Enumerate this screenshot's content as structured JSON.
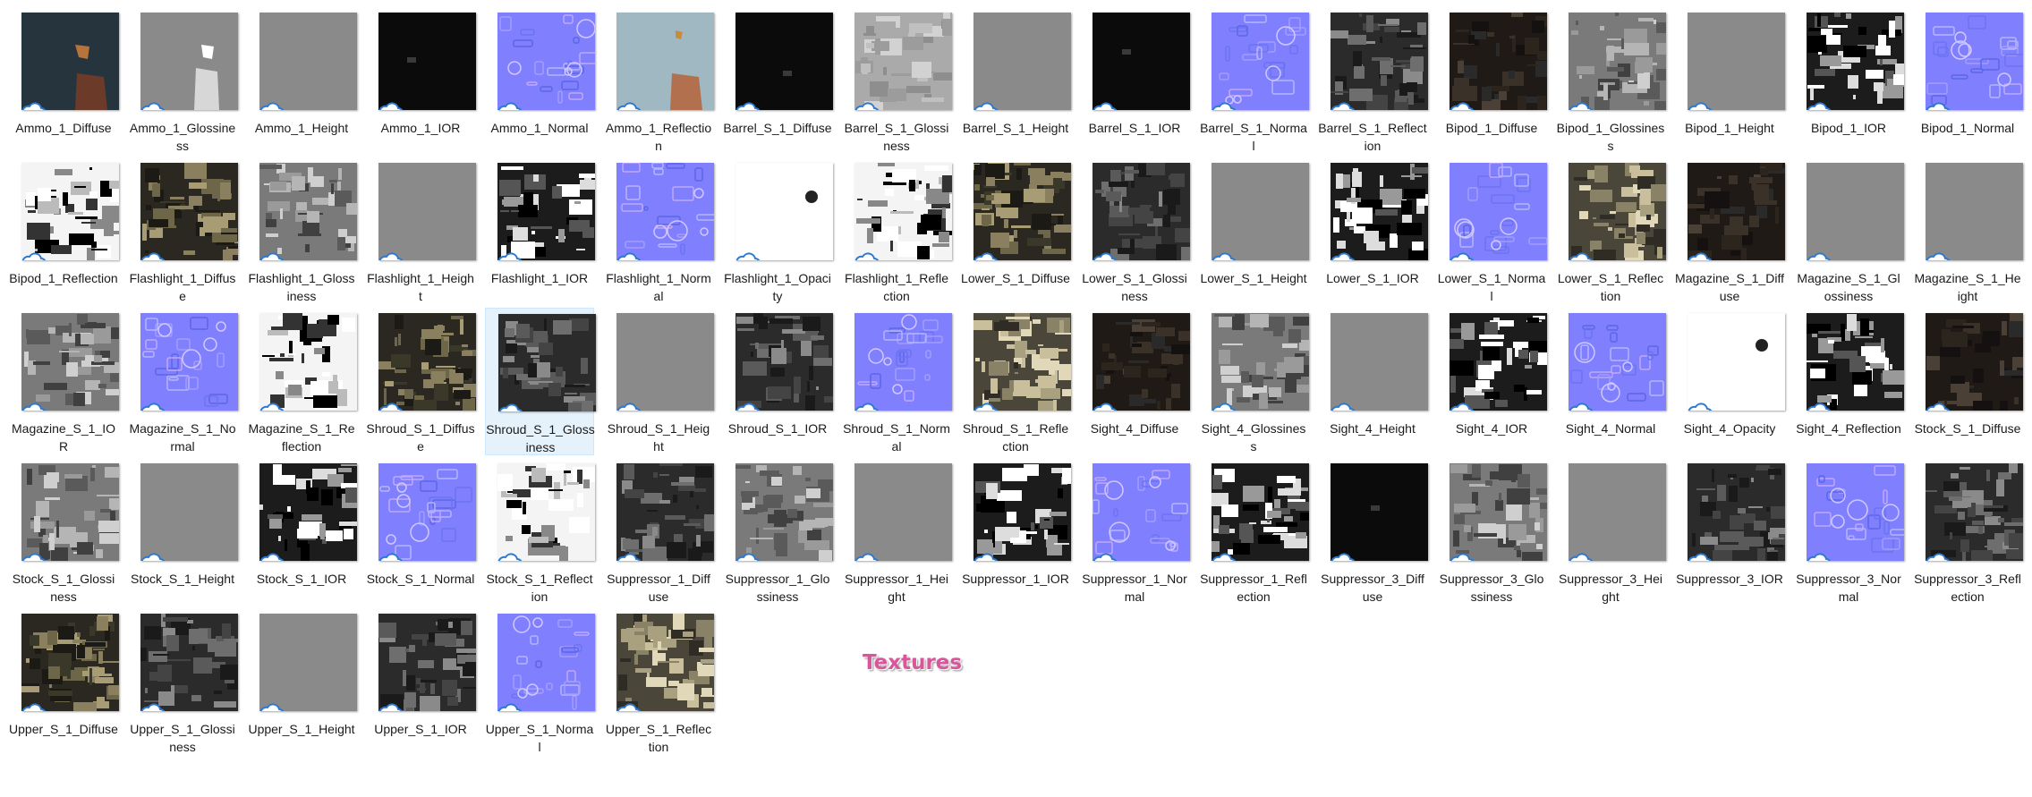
{
  "files": [
    {
      "name": "Ammo_1_Diffuse",
      "kind": "ammo_diffuse"
    },
    {
      "name": "Ammo_1_Glossiness",
      "kind": "ammo_gloss"
    },
    {
      "name": "Ammo_1_Height",
      "kind": "flatgray"
    },
    {
      "name": "Ammo_1_IOR",
      "kind": "black"
    },
    {
      "name": "Ammo_1_Normal",
      "kind": "normal"
    },
    {
      "name": "Ammo_1_Reflection",
      "kind": "ammo_refl"
    },
    {
      "name": "Barrel_S_1_Diffuse",
      "kind": "black"
    },
    {
      "name": "Barrel_S_1_Glossiness",
      "kind": "lightgray_tex"
    },
    {
      "name": "Barrel_S_1_Height",
      "kind": "flatgray"
    },
    {
      "name": "Barrel_S_1_IOR",
      "kind": "black"
    },
    {
      "name": "Barrel_S_1_Normal",
      "kind": "normal"
    },
    {
      "name": "Barrel_S_1_Reflection",
      "kind": "darkgray_tex"
    },
    {
      "name": "Bipod_1_Diffuse",
      "kind": "darkbrown_tex"
    },
    {
      "name": "Bipod_1_Glossiness",
      "kind": "gray_tex"
    },
    {
      "name": "Bipod_1_Height",
      "kind": "flatgray"
    },
    {
      "name": "Bipod_1_IOR",
      "kind": "bw_tex"
    },
    {
      "name": "Bipod_1_Normal",
      "kind": "normal"
    },
    {
      "name": "Bipod_1_Reflection",
      "kind": "white_tex"
    },
    {
      "name": "Flashlight_1_Diffuse",
      "kind": "darkolive_tex"
    },
    {
      "name": "Flashlight_1_Glossiness",
      "kind": "gray_tex"
    },
    {
      "name": "Flashlight_1_Height",
      "kind": "flatgray"
    },
    {
      "name": "Flashlight_1_IOR",
      "kind": "bw_tex"
    },
    {
      "name": "Flashlight_1_Normal",
      "kind": "normal"
    },
    {
      "name": "Flashlight_1_Opacity",
      "kind": "white"
    },
    {
      "name": "Flashlight_1_Reflection",
      "kind": "white_tex"
    },
    {
      "name": "Lower_S_1_Diffuse",
      "kind": "darkolive_tex"
    },
    {
      "name": "Lower_S_1_Glossiness",
      "kind": "darkgray_tex"
    },
    {
      "name": "Lower_S_1_Height",
      "kind": "flatgray"
    },
    {
      "name": "Lower_S_1_IOR",
      "kind": "bw_tex"
    },
    {
      "name": "Lower_S_1_Normal",
      "kind": "normal"
    },
    {
      "name": "Lower_S_1_Reflection",
      "kind": "beige_tex"
    },
    {
      "name": "Magazine_S_1_Diffuse",
      "kind": "darkbrown_tex"
    },
    {
      "name": "Magazine_S_1_Glossiness",
      "kind": "flatgray"
    },
    {
      "name": "Magazine_S_1_Height",
      "kind": "flatgray"
    },
    {
      "name": "Magazine_S_1_IOR",
      "kind": "gray_tex"
    },
    {
      "name": "Magazine_S_1_Normal",
      "kind": "normal"
    },
    {
      "name": "Magazine_S_1_Reflection",
      "kind": "white_tex"
    },
    {
      "name": "Shroud_S_1_Diffuse",
      "kind": "darkolive_tex"
    },
    {
      "name": "Shroud_S_1_Glossiness",
      "kind": "darkgray_tex"
    },
    {
      "name": "Shroud_S_1_Height",
      "kind": "flatgray"
    },
    {
      "name": "Shroud_S_1_IOR",
      "kind": "darkgray_tex"
    },
    {
      "name": "Shroud_S_1_Normal",
      "kind": "normal"
    },
    {
      "name": "Shroud_S_1_Reflection",
      "kind": "beige_tex"
    },
    {
      "name": "Sight_4_Diffuse",
      "kind": "darkbrown_tex"
    },
    {
      "name": "Sight_4_Glossiness",
      "kind": "gray_tex"
    },
    {
      "name": "Sight_4_Height",
      "kind": "flatgray"
    },
    {
      "name": "Sight_4_IOR",
      "kind": "bw_tex"
    },
    {
      "name": "Sight_4_Normal",
      "kind": "normal"
    },
    {
      "name": "Sight_4_Opacity",
      "kind": "white"
    },
    {
      "name": "Sight_4_Reflection",
      "kind": "bw_tex"
    },
    {
      "name": "Stock_S_1_Diffuse",
      "kind": "darkbrown_tex"
    },
    {
      "name": "Stock_S_1_Glossiness",
      "kind": "gray_tex"
    },
    {
      "name": "Stock_S_1_Height",
      "kind": "flatgray"
    },
    {
      "name": "Stock_S_1_IOR",
      "kind": "bw_tex"
    },
    {
      "name": "Stock_S_1_Normal",
      "kind": "normal"
    },
    {
      "name": "Stock_S_1_Reflection",
      "kind": "white_tex"
    },
    {
      "name": "Suppressor_1_Diffuse",
      "kind": "darkgray_tex"
    },
    {
      "name": "Suppressor_1_Glossiness",
      "kind": "gray_tex"
    },
    {
      "name": "Suppressor_1_Height",
      "kind": "flatgray"
    },
    {
      "name": "Suppressor_1_IOR",
      "kind": "bw_tex"
    },
    {
      "name": "Suppressor_1_Normal",
      "kind": "normal"
    },
    {
      "name": "Suppressor_1_Reflection",
      "kind": "bw_tex"
    },
    {
      "name": "Suppressor_3_Diffuse",
      "kind": "black"
    },
    {
      "name": "Suppressor_3_Glossiness",
      "kind": "gray_tex"
    },
    {
      "name": "Suppressor_3_Height",
      "kind": "flatgray"
    },
    {
      "name": "Suppressor_3_IOR",
      "kind": "darkgray_tex"
    },
    {
      "name": "Suppressor_3_Normal",
      "kind": "normal"
    },
    {
      "name": "Suppressor_3_Reflection",
      "kind": "darkgray_tex"
    },
    {
      "name": "Upper_S_1_Diffuse",
      "kind": "darkolive_tex"
    },
    {
      "name": "Upper_S_1_Glossiness",
      "kind": "darkgray_tex"
    },
    {
      "name": "Upper_S_1_Height",
      "kind": "flatgray"
    },
    {
      "name": "Upper_S_1_IOR",
      "kind": "darkgray_tex"
    },
    {
      "name": "Upper_S_1_Normal",
      "kind": "normal"
    },
    {
      "name": "Upper_S_1_Reflection",
      "kind": "beige_tex"
    }
  ],
  "selected_file": "Shroud_S_1_Glossiness",
  "status_icon": "cloud-icon",
  "watermark": "Textures",
  "colors": {
    "normal_map": "#8080ff",
    "selection_bg": "#e5f1fb",
    "watermark": "#d9569b",
    "cloud_stroke": "#2b79d0"
  }
}
